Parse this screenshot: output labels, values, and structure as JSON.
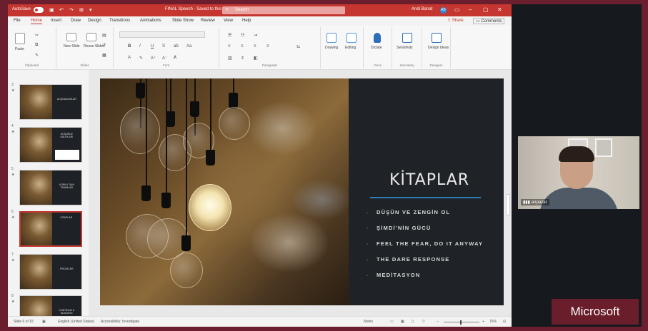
{
  "titlebar": {
    "autosave_label": "AutoSave",
    "toggle_state": "On",
    "doc_title": "FINAL Speech - Saved to this PC",
    "search_placeholder": "Search",
    "user_name": "Andi Banat",
    "user_initials": "AB"
  },
  "tabs": [
    "File",
    "Home",
    "Insert",
    "Draw",
    "Design",
    "Transitions",
    "Animations",
    "Slide Show",
    "Review",
    "View",
    "Help"
  ],
  "active_tab": "Home",
  "share_label": "Share",
  "comments_label": "Comments",
  "ribbon": {
    "groups": [
      "Clipboard",
      "Slides",
      "Font",
      "Paragraph",
      "Voice",
      "Sensitivity",
      "Designer"
    ],
    "buttons": {
      "paste": "Paste",
      "new_slide": "New Slide",
      "reuse_slides": "Reuse Slides",
      "drawing": "Drawing",
      "editing": "Editing",
      "dictate": "Dictate",
      "sensitivity": "Sensitivity",
      "design_ideas": "Design Ideas"
    }
  },
  "thumbnails": [
    {
      "number": "3",
      "text": "ALIŞKANLIKLAR"
    },
    {
      "number": "4",
      "text": "DÜŞÜNCE KALIPLARI"
    },
    {
      "number": "5",
      "text": "KORKU TANI TANIMLAR"
    },
    {
      "number": "6",
      "text": "KİTAPLAR"
    },
    {
      "number": "7",
      "text": "PROJELER"
    },
    {
      "number": "8",
      "text": "CONTINUE & BUILDING"
    }
  ],
  "selected_thumbnail": "6",
  "slide": {
    "title": "KİTAPLAR",
    "bullets": [
      "DÜŞÜN VE ZENGİN OL",
      "ŞİMDİ'NİN GÜCÜ",
      "FEEL THE FEAR, DO IT ANYWAY",
      "THE DARE RESPONSE",
      "MEDİTASYON"
    ],
    "accent_color": "#2e7db5"
  },
  "statusbar": {
    "slide_counter": "Slide 6 of 15",
    "language": "English (United States)",
    "accessibility": "Accessibility: Investigate",
    "notes": "Notes",
    "zoom": "76%"
  },
  "webcam": {
    "label": "arıpazar"
  },
  "watermark": "Microsoft",
  "colors": {
    "brand_red": "#c4362f",
    "frame_maroon": "#6b1f2e"
  }
}
